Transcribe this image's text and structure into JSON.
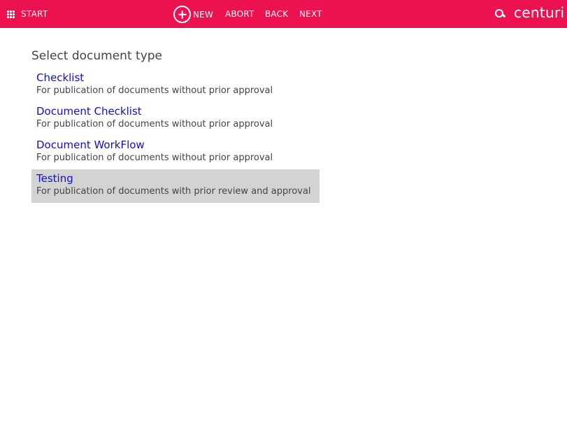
{
  "topbar": {
    "start_label": "START",
    "new_label": "NEW",
    "abort_label": "ABORT",
    "back_label": "BACK",
    "next_label": "NEXT",
    "brand": "centuri",
    "color": "#ec1250"
  },
  "page": {
    "title": "Select document type"
  },
  "documents": [
    {
      "name": "Checklist",
      "description": "For publication of documents without prior approval",
      "selected": false
    },
    {
      "name": "Document Checklist",
      "description": "For publication of documents without prior approval",
      "selected": false
    },
    {
      "name": "Document WorkFlow",
      "description": "For publication of documents without prior approval",
      "selected": false
    },
    {
      "name": "Testing",
      "description": "For publication of documents with prior review and approval",
      "selected": true
    }
  ]
}
